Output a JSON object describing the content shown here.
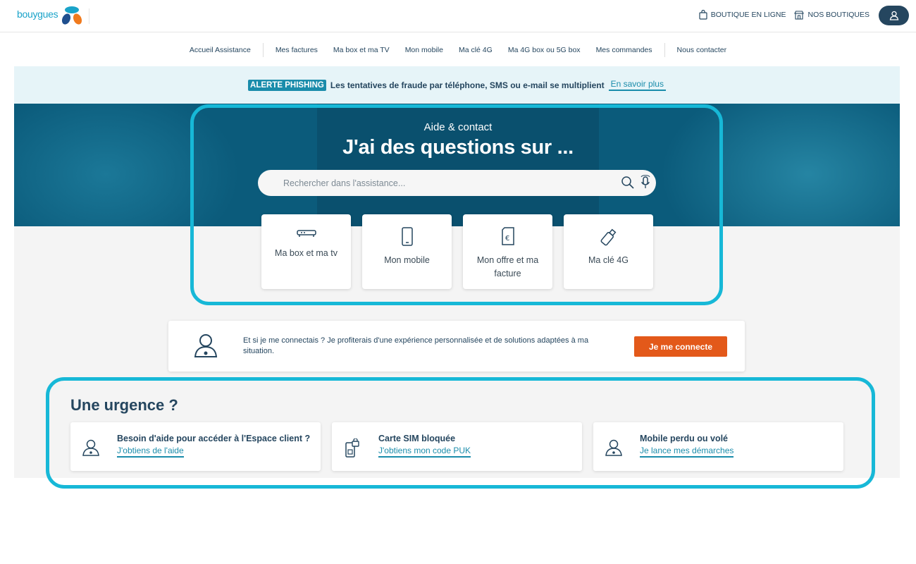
{
  "header": {
    "brand": "bouygues",
    "links": [
      {
        "label": "BOUTIQUE EN LIGNE",
        "icon": "shopping-bag-icon"
      },
      {
        "label": "NOS BOUTIQUES",
        "icon": "store-icon"
      }
    ],
    "account_icon": "user-icon"
  },
  "nav": {
    "items": [
      "Accueil Assistance",
      "Mes factures",
      "Ma box et ma TV",
      "Mon mobile",
      "Ma clé 4G",
      "Ma 4G box ou 5G box",
      "Mes commandes",
      "Nous contacter"
    ]
  },
  "alert": {
    "badge": "ALERTE PHISHING",
    "text": "Les tentatives de fraude par téléphone, SMS ou e-mail se multiplient",
    "link": "En savoir plus"
  },
  "hero": {
    "subtitle": "Aide & contact",
    "title": "J'ai des questions sur ...",
    "search_placeholder": "Rechercher dans l'assistance...",
    "categories": [
      {
        "label": "Ma box et ma tv",
        "icon": "tv-box-icon"
      },
      {
        "label": "Mon mobile",
        "icon": "mobile-phone-icon"
      },
      {
        "label": "Mon offre et ma facture",
        "icon": "invoice-euro-icon"
      },
      {
        "label": "Ma clé 4G",
        "icon": "usb-key-icon"
      }
    ]
  },
  "connect": {
    "text": "Et si je me connectais ? Je profiterais d'une expérience personnalisée et de solutions adaptées à ma situation.",
    "button": "Je me connecte"
  },
  "urgence": {
    "title": "Une urgence ?",
    "cards": [
      {
        "title": "Besoin d'aide pour accéder à l'Espace client ?",
        "link": "J'obtiens de l'aide",
        "icon": "user-icon"
      },
      {
        "title": "Carte SIM bloquée",
        "link": "J'obtiens mon code PUK",
        "icon": "sim-lock-icon"
      },
      {
        "title": "Mobile perdu ou volé",
        "link": "Je lance mes démarches",
        "icon": "user-icon"
      }
    ]
  },
  "colors": {
    "primary": "#25465f",
    "accent": "#1a8cab",
    "highlight": "#17b8d7",
    "cta": "#e3591a",
    "hero_bg": "#0b5b7b"
  }
}
